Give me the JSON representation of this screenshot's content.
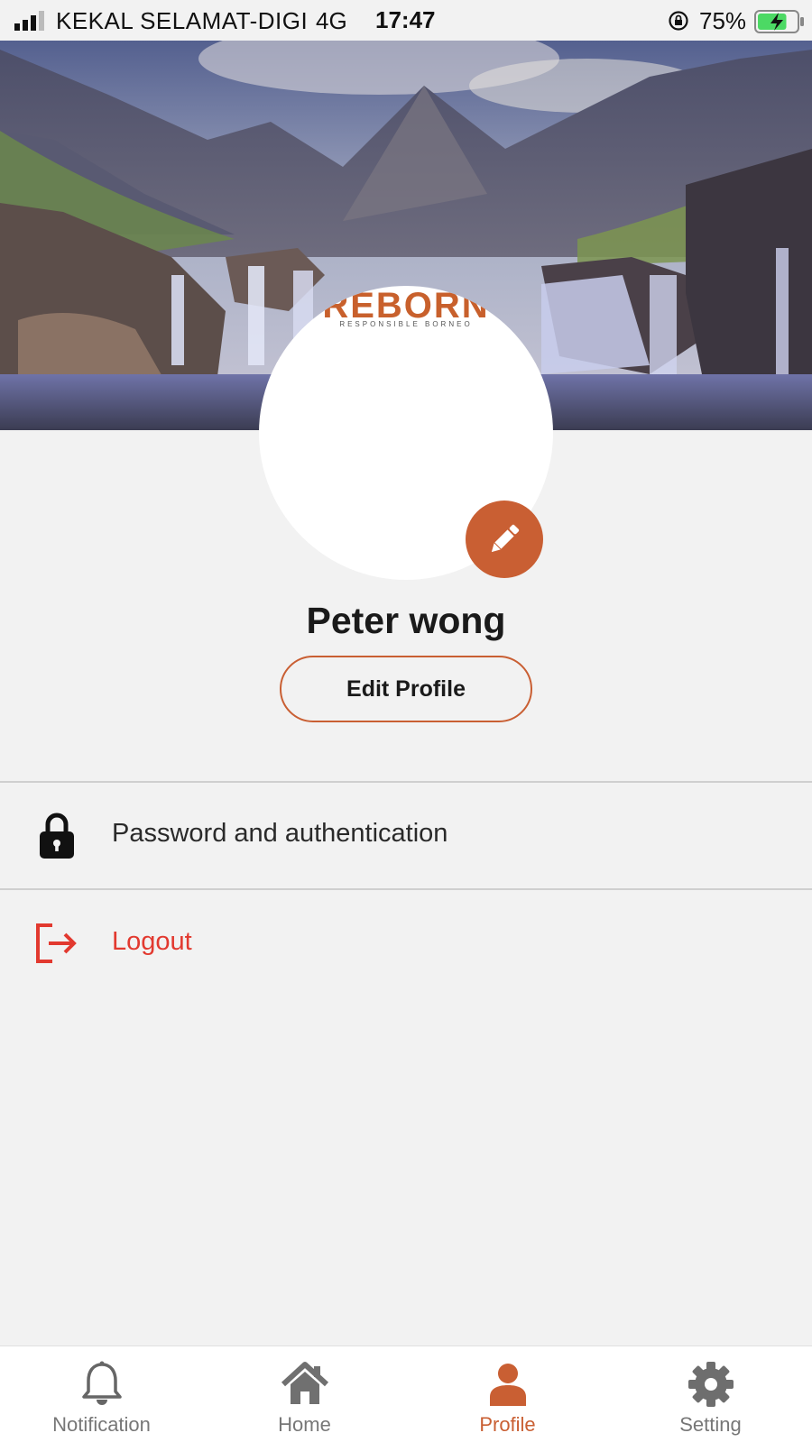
{
  "status_bar": {
    "carrier": "KEKAL SELAMAT-DIGI",
    "network": "4G",
    "time": "17:47",
    "battery_percent": "75%",
    "battery_level": 0.75
  },
  "avatar": {
    "logo_text": "REBORN",
    "logo_subtext": "RESPONSIBLE BORNEO"
  },
  "profile": {
    "name": "Peter wong",
    "edit_button": "Edit Profile"
  },
  "menu": {
    "password_label": "Password and authentication",
    "logout_label": "Logout"
  },
  "tabs": [
    {
      "label": "Notification",
      "icon": "bell-icon"
    },
    {
      "label": "Home",
      "icon": "home-icon"
    },
    {
      "label": "Profile",
      "icon": "person-icon",
      "active": true
    },
    {
      "label": "Setting",
      "icon": "gear-icon"
    }
  ],
  "colors": {
    "accent": "#c95f33",
    "logout": "#e2392f",
    "background": "#f2f2f2"
  }
}
